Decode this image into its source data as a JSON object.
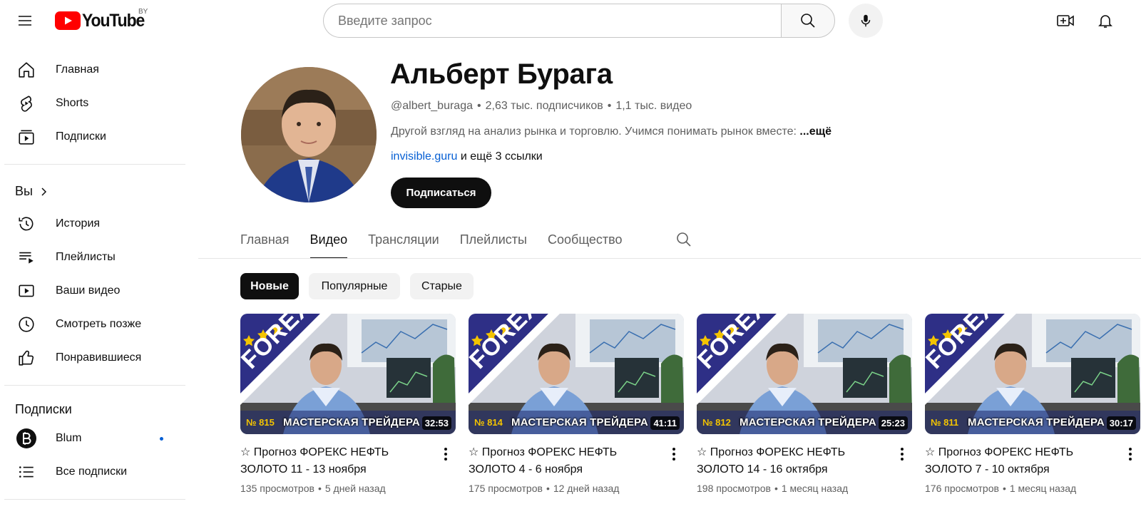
{
  "header": {
    "logo_text": "YouTube",
    "country_code": "BY",
    "search_placeholder": "Введите запрос"
  },
  "sidebar": {
    "main": [
      {
        "label": "Главная",
        "icon": "home-icon"
      },
      {
        "label": "Shorts",
        "icon": "shorts-icon"
      },
      {
        "label": "Подписки",
        "icon": "subscriptions-icon"
      }
    ],
    "you_heading": "Вы",
    "you_items": [
      {
        "label": "История",
        "icon": "history-icon"
      },
      {
        "label": "Плейлисты",
        "icon": "playlists-icon"
      },
      {
        "label": "Ваши видео",
        "icon": "your-videos-icon"
      },
      {
        "label": "Смотреть позже",
        "icon": "watch-later-icon"
      },
      {
        "label": "Понравившиеся",
        "icon": "liked-icon"
      }
    ],
    "subs_heading": "Подписки",
    "subs_items": [
      {
        "label": "Blum",
        "icon": "blum-avatar-icon",
        "has_new": true
      },
      {
        "label": "Все подписки",
        "icon": "all-subscriptions-icon"
      }
    ]
  },
  "channel": {
    "name": "Альберт Бурага",
    "handle": "@albert_buraga",
    "subscribers": "2,63 тыс. подписчиков",
    "videos_count": "1,1 тыс. видео",
    "description": "Другой взгляд на анализ рынка и торговлю. Учимся понимать рынок вместе: ",
    "more": "...ещё",
    "link": "invisible.guru",
    "more_links": " и ещё 3 ссылки",
    "subscribe_label": "Подписаться"
  },
  "tabs": [
    {
      "label": "Главная",
      "active": false
    },
    {
      "label": "Видео",
      "active": true
    },
    {
      "label": "Трансляции",
      "active": false
    },
    {
      "label": "Плейлисты",
      "active": false
    },
    {
      "label": "Сообщество",
      "active": false
    }
  ],
  "chips": [
    {
      "label": "Новые",
      "active": true
    },
    {
      "label": "Популярные",
      "active": false
    },
    {
      "label": "Старые",
      "active": false
    }
  ],
  "videos": [
    {
      "thumb_number": "№ 815",
      "thumb_caption": "МАСТЕРСКАЯ ТРЕЙДЕРА",
      "thumb_badge": "FOREX",
      "duration": "32:53",
      "title": "☆ Прогноз ФОРЕКС НЕФТЬ ЗОЛОТО 11 - 13 ноября",
      "views": "135 просмотров",
      "age": "5 дней назад"
    },
    {
      "thumb_number": "№ 814",
      "thumb_caption": "МАСТЕРСКАЯ ТРЕЙДЕРА",
      "thumb_badge": "FOREX",
      "duration": "41:11",
      "title": "☆ Прогноз ФОРЕКС НЕФТЬ ЗОЛОТО 4 - 6 ноября",
      "views": "175 просмотров",
      "age": "12 дней назад"
    },
    {
      "thumb_number": "№ 812",
      "thumb_caption": "МАСТЕРСКАЯ ТРЕЙДЕРА",
      "thumb_badge": "FOREX",
      "duration": "25:23",
      "title": "☆ Прогноз ФОРЕКС НЕФТЬ ЗОЛОТО 14 - 16 октября",
      "views": "198 просмотров",
      "age": "1 месяц назад"
    },
    {
      "thumb_number": "№ 811",
      "thumb_caption": "МАСТЕРСКАЯ ТРЕЙДЕРА",
      "thumb_badge": "FOREX",
      "duration": "30:17",
      "title": "☆ Прогноз ФОРЕКС НЕФТЬ ЗОЛОТО 7 - 10 октября",
      "views": "176 просмотров",
      "age": "1 месяц назад"
    }
  ],
  "colors": {
    "brand_red": "#ff0000",
    "link_blue": "#065fd4",
    "text_primary": "#0f0f0f",
    "text_secondary": "#606060",
    "chip_bg": "#f2f2f2",
    "forex_band": "#2e2f86"
  }
}
